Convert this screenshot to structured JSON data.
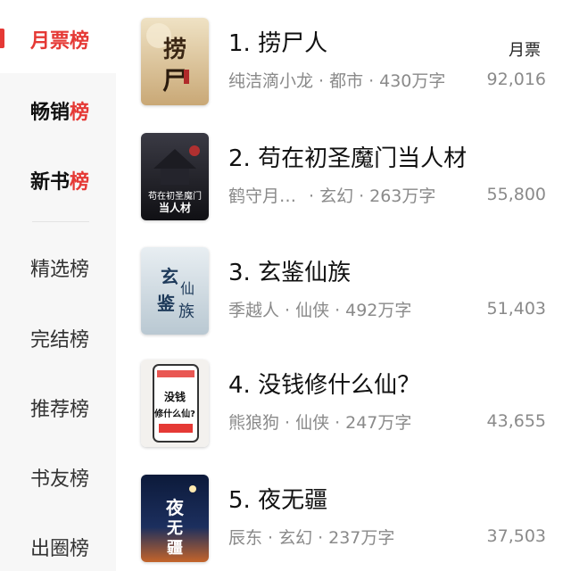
{
  "sidebar": {
    "items": [
      {
        "label": "月票榜"
      },
      {
        "label_head": "畅销",
        "label_tail": "榜"
      },
      {
        "label_head": "新书",
        "label_tail": "榜"
      },
      {
        "label": "精选榜"
      },
      {
        "label": "完结榜"
      },
      {
        "label": "推荐榜"
      },
      {
        "label": "书友榜"
      },
      {
        "label": "出圈榜"
      }
    ]
  },
  "list": {
    "metric_label": "月票",
    "books": [
      {
        "title": "1. 捞尸人",
        "author": "纯洁滴小龙",
        "genre": "都市",
        "words": "430万字",
        "count": "92,016",
        "cover_text": "捞尸人"
      },
      {
        "title": "2. 苟在初圣魔门当人材",
        "author": "鹤守月…",
        "genre": "玄幻",
        "words": "263万字",
        "count": "55,800",
        "cover_text": "苟在初圣魔门当人材"
      },
      {
        "title": "3. 玄鉴仙族",
        "author": "季越人",
        "genre": "仙侠",
        "words": "492万字",
        "count": "51,403",
        "cover_text": "玄鉴仙族"
      },
      {
        "title": "4. 没钱修什么仙？",
        "author": "熊狼狗",
        "genre": "仙侠",
        "words": "247万字",
        "count": "43,655",
        "cover_text": "没钱修什么仙？"
      },
      {
        "title": "5. 夜无疆",
        "author": "辰东",
        "genre": "玄幻",
        "words": "237万字",
        "count": "37,503",
        "cover_text": "夜无疆"
      }
    ]
  },
  "colors": {
    "accent": "#e53935",
    "sidebar_bg": "#f7f7f7",
    "meta_text": "#8a8a8a"
  }
}
